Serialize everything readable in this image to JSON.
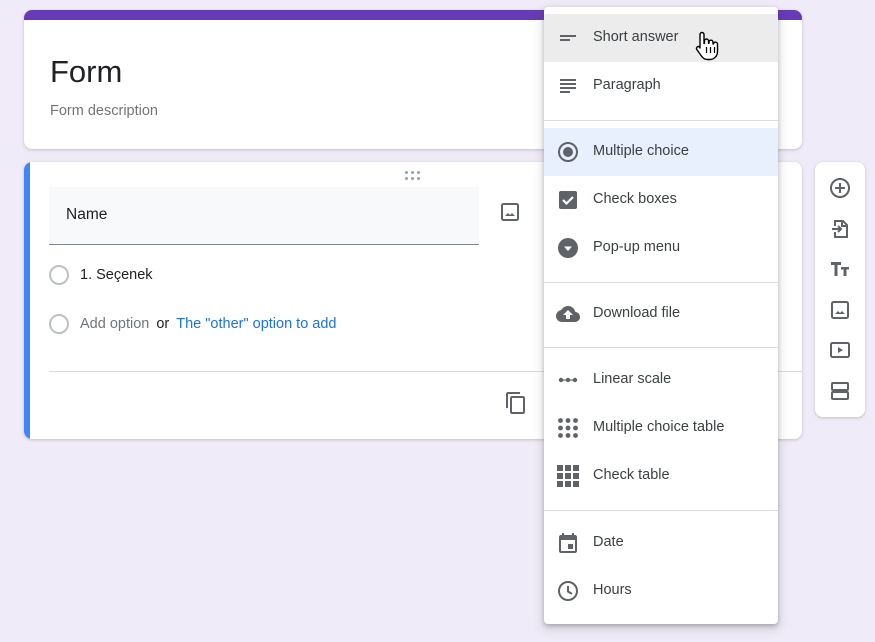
{
  "header": {
    "title": "Form",
    "description": "Form description",
    "accent_color": "#673ab7"
  },
  "question": {
    "title": "Name",
    "options": [
      "1. Seçenek"
    ],
    "add_option_label": "Add option",
    "or_label": "or",
    "add_other_label": "The \"other\" option to add",
    "accent_color": "#4285f4"
  },
  "question_type_menu": {
    "items": [
      {
        "label": "Short answer",
        "icon": "short-answer-icon",
        "state": "hover"
      },
      {
        "label": "Paragraph",
        "icon": "paragraph-icon"
      },
      {
        "label": "Multiple choice",
        "icon": "radio-button-icon",
        "state": "selected"
      },
      {
        "label": "Check boxes",
        "icon": "checkbox-icon"
      },
      {
        "label": "Pop-up menu",
        "icon": "dropdown-icon"
      },
      {
        "label": "Download file",
        "icon": "cloud-upload-icon"
      },
      {
        "label": "Linear scale",
        "icon": "linear-scale-icon"
      },
      {
        "label": "Multiple choice table",
        "icon": "grid-dots-icon"
      },
      {
        "label": "Check table",
        "icon": "grid-squares-icon"
      },
      {
        "label": "Date",
        "icon": "calendar-icon"
      },
      {
        "label": "Hours",
        "icon": "clock-icon"
      }
    ]
  },
  "toolbar": {
    "items": [
      {
        "name": "add-question",
        "icon": "add-circle-icon"
      },
      {
        "name": "import-questions",
        "icon": "import-icon"
      },
      {
        "name": "add-title-description",
        "icon": "text-title-icon"
      },
      {
        "name": "add-image",
        "icon": "image-icon"
      },
      {
        "name": "add-video",
        "icon": "video-icon"
      },
      {
        "name": "add-section",
        "icon": "section-icon"
      }
    ]
  }
}
